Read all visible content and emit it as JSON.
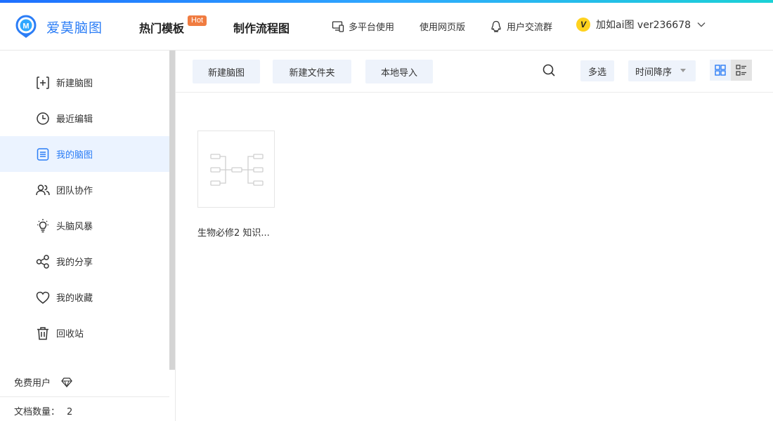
{
  "brand": {
    "name": "爱莫脑图",
    "accent": "#2b7df6"
  },
  "header": {
    "nav_hot": "热门模板",
    "hot_badge": "Hot",
    "nav_flow": "制作流程图",
    "link_platform": "多平台使用",
    "link_web": "使用网页版",
    "link_group": "用户交流群",
    "user_avatar": "V",
    "user_name": "加如ai图 ver236678"
  },
  "sidebar": {
    "items": [
      {
        "label": "新建脑图",
        "icon": "add-box-icon"
      },
      {
        "label": "最近编辑",
        "icon": "clock-icon"
      },
      {
        "label": "我的脑图",
        "icon": "document-list-icon",
        "active": true
      },
      {
        "label": "团队协作",
        "icon": "team-icon"
      },
      {
        "label": "头脑风暴",
        "icon": "lightbulb-icon"
      },
      {
        "label": "我的分享",
        "icon": "share-icon"
      },
      {
        "label": "我的收藏",
        "icon": "heart-icon"
      },
      {
        "label": "回收站",
        "icon": "trash-icon"
      }
    ],
    "free_user": "免费用户",
    "doc_count_label": "文档数量：",
    "doc_count_value": "2"
  },
  "toolbar": {
    "new_map": "新建脑图",
    "new_folder": "新建文件夹",
    "import": "本地导入",
    "multi_select": "多选",
    "sort": "时间降序"
  },
  "documents": [
    {
      "title": "生物必修2 知识..."
    }
  ]
}
